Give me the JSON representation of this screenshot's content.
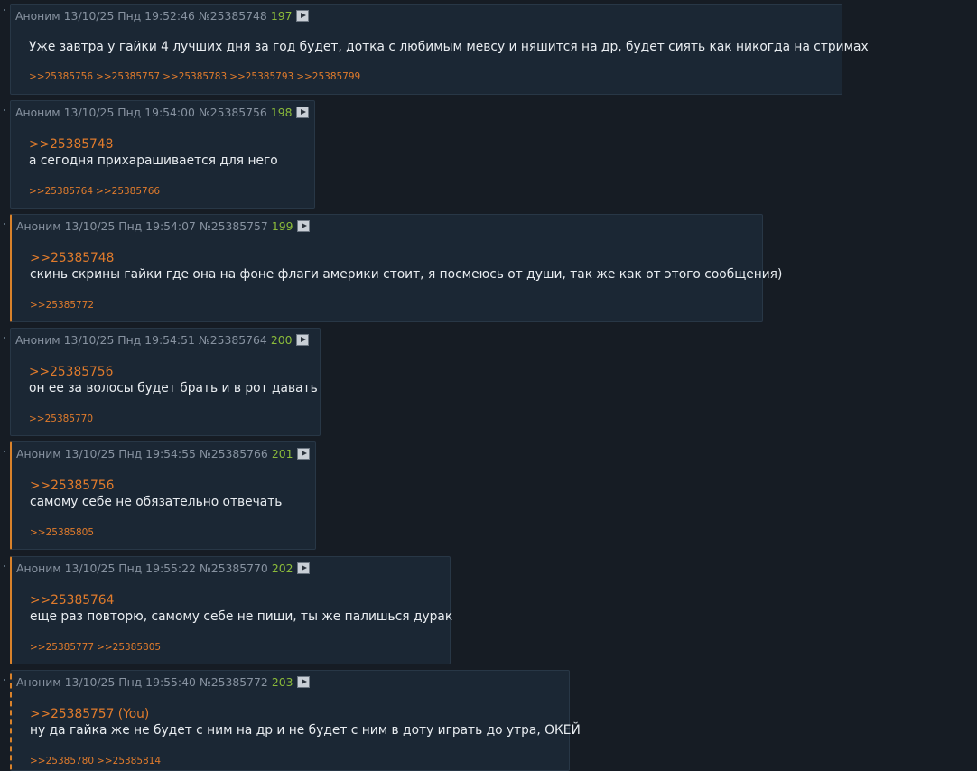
{
  "posts": [
    {
      "author": "Аноним",
      "date": "13/10/25 Пнд 19:52:46",
      "id": "№25385748",
      "num": "197",
      "reply_to": "",
      "text": "Уже завтра у гайки 4 лучших дня за год будет, дотка с любимым мевсу и няшится на др, будет сиять как никогда на стримах",
      "answers": [
        ">>25385756",
        ">>25385757",
        ">>25385783",
        ">>25385793",
        ">>25385799"
      ]
    },
    {
      "author": "Аноним",
      "date": "13/10/25 Пнд 19:54:00",
      "id": "№25385756",
      "num": "198",
      "reply_to": ">>25385748",
      "text": "а сегодня прихарашивается для него",
      "answers": [
        ">>25385764",
        ">>25385766"
      ]
    },
    {
      "author": "Аноним",
      "date": "13/10/25 Пнд 19:54:07",
      "id": "№25385757",
      "num": "199",
      "reply_to": ">>25385748",
      "text": "скинь скрины гайки где она на фоне флаги америки стоит, я посмеюсь от души, так же как от этого сообщения)",
      "answers": [
        ">>25385772"
      ]
    },
    {
      "author": "Аноним",
      "date": "13/10/25 Пнд 19:54:51",
      "id": "№25385764",
      "num": "200",
      "reply_to": ">>25385756",
      "text": "он ее за волосы будет брать и в рот давать",
      "answers": [
        ">>25385770"
      ]
    },
    {
      "author": "Аноним",
      "date": "13/10/25 Пнд 19:54:55",
      "id": "№25385766",
      "num": "201",
      "reply_to": ">>25385756",
      "text": "самому себе не обязательно отвечать",
      "answers": [
        ">>25385805"
      ]
    },
    {
      "author": "Аноним",
      "date": "13/10/25 Пнд 19:55:22",
      "id": "№25385770",
      "num": "202",
      "reply_to": ">>25385764",
      "text": "еще раз повторю, самому себе не пиши, ты же палишься дурак",
      "answers": [
        ">>25385777",
        ">>25385805"
      ]
    },
    {
      "author": "Аноним",
      "date": "13/10/25 Пнд 19:55:40",
      "id": "№25385772",
      "num": "203",
      "reply_to": ">>25385757 (You)",
      "text": "ну да гайка же не будет с ним на др и не будет с ним в доту играть до утра, ОКЕЙ",
      "answers": [
        ">>25385780",
        ">>25385814"
      ]
    }
  ],
  "colors": {
    "background": "#161c24",
    "post_background": "#1b2734",
    "link": "#e07b2c",
    "post_number": "#8bbb3a",
    "meta": "#8792a0",
    "text": "#e9edf1"
  },
  "icons": {
    "expand": "play-triangle-icon"
  }
}
